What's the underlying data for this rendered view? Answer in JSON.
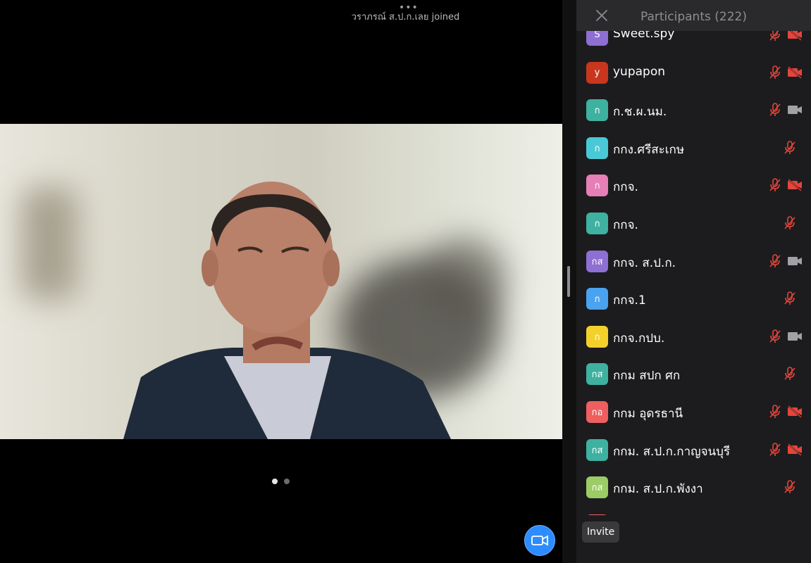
{
  "meeting": {
    "join_notice": "วราภรณ์ ส.ป.ก.เลย joined",
    "page_count": 2,
    "current_page": 1
  },
  "icons": {
    "more": "more-dots-icon",
    "close": "close-icon",
    "video": "video-camera-icon",
    "mic_muted": "mic-muted-icon",
    "cam_off": "camera-off-icon",
    "cam_on": "camera-on-icon"
  },
  "colors": {
    "accent": "#2d8cff",
    "muted_red": "#e5453b",
    "panel_bg": "#1c1c1e"
  },
  "participants_panel": {
    "title": "Participants (222)",
    "invite_label": "Invite",
    "participants": [
      {
        "initials": "S",
        "name": "Sweet.spy",
        "color": "#8e6fd3",
        "mic": "muted",
        "camera": "off"
      },
      {
        "initials": "y",
        "name": "yupapon",
        "color": "#c8361e",
        "mic": "muted",
        "camera": "off"
      },
      {
        "initials": "ก",
        "name": "ก.ช.ผ.นม.",
        "color": "#3eb1a0",
        "mic": "muted",
        "camera": "on"
      },
      {
        "initials": "ก",
        "name": "กกง.ศรีสะเกษ",
        "color": "#49c9d6",
        "mic": "muted",
        "camera": "none"
      },
      {
        "initials": "ก",
        "name": "กกจ.",
        "color": "#e57fb6",
        "mic": "muted",
        "camera": "off"
      },
      {
        "initials": "ก",
        "name": "กกจ.",
        "color": "#3eb1a0",
        "mic": "muted",
        "camera": "none"
      },
      {
        "initials": "กส",
        "name": "กกจ. ส.ป.ก.",
        "color": "#8e6fd3",
        "mic": "muted",
        "camera": "on"
      },
      {
        "initials": "ก",
        "name": "กกจ.1",
        "color": "#4aa3f0",
        "mic": "muted",
        "camera": "none"
      },
      {
        "initials": "ก",
        "name": "กกจ.กปบ.",
        "color": "#f3d12a",
        "mic": "muted",
        "camera": "on"
      },
      {
        "initials": "กส",
        "name": "กกม สปก ศก",
        "color": "#3eb1a0",
        "mic": "muted",
        "camera": "none"
      },
      {
        "initials": "กอ",
        "name": "กกม อุดรธานี",
        "color": "#ef5f5f",
        "mic": "muted",
        "camera": "off"
      },
      {
        "initials": "กส",
        "name": "กกม. ส.ป.ก.กาญจนบุรี",
        "color": "#3eb1a0",
        "mic": "muted",
        "camera": "off"
      },
      {
        "initials": "กส",
        "name": "กกม. ส.ป.ก.พังงา",
        "color": "#9ccc65",
        "mic": "muted",
        "camera": "none"
      },
      {
        "initials": "",
        "name": "",
        "color": "#ef5f5f",
        "mic": "none",
        "camera": "none"
      }
    ]
  }
}
